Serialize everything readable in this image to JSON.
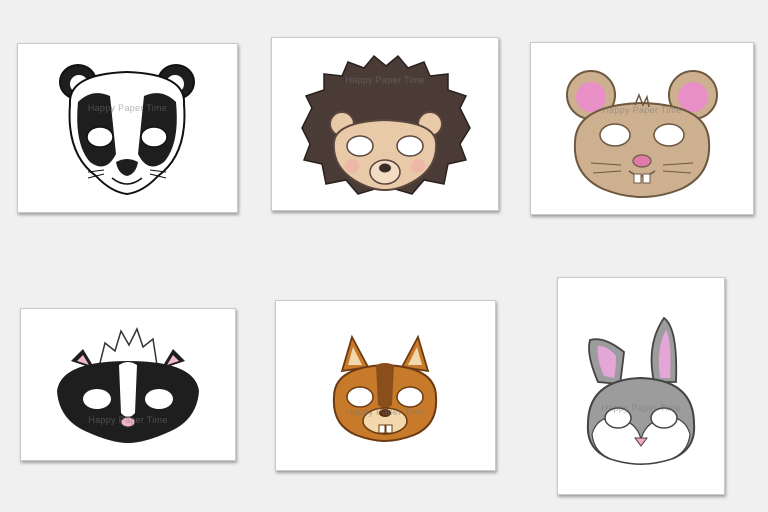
{
  "watermark": "Happy Paper Time",
  "cards": [
    {
      "mask": "badger-mask"
    },
    {
      "mask": "hedgehog-mask"
    },
    {
      "mask": "mouse-mask"
    },
    {
      "mask": "skunk-mask"
    },
    {
      "mask": "squirrel-mask"
    },
    {
      "mask": "rabbit-mask"
    }
  ],
  "colors": {
    "background": "#f0f0f0",
    "card": "#ffffff",
    "badger_black": "#1e1e1e",
    "hedgehog_spines": "#4a3b36",
    "hedgehog_face": "#e8caa8",
    "mouse_fur": "#cdb08f",
    "mouse_ear_pink": "#e98fc8",
    "skunk_black": "#1e1e1e",
    "squirrel_orange": "#c77a2a",
    "squirrel_dark": "#8a4e1c",
    "rabbit_grey": "#9c9c9c",
    "rabbit_ear_pink": "#e4a6d6"
  }
}
